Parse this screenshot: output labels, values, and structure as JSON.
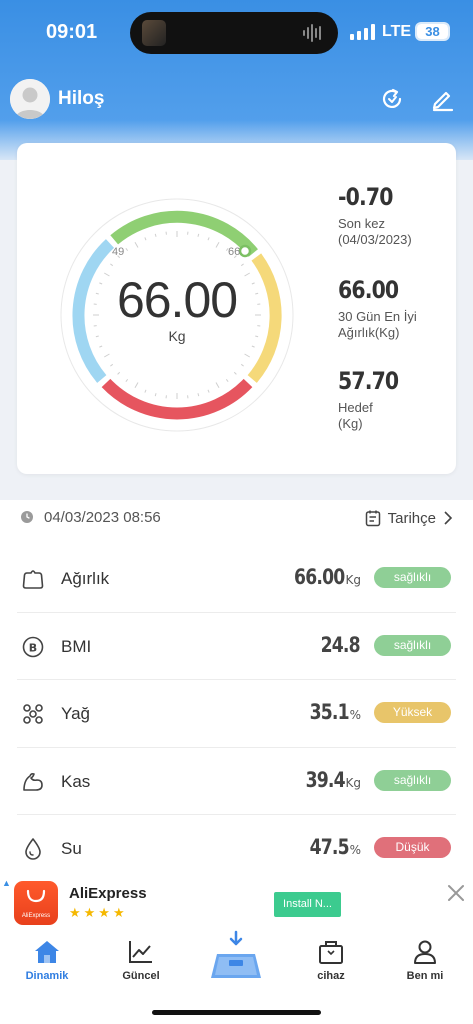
{
  "status_bar": {
    "time": "09:01",
    "network": "LTE",
    "battery": "38"
  },
  "profile": {
    "name": "Hiloş"
  },
  "gauge": {
    "value": "66.00",
    "unit": "Kg",
    "min_label": "49",
    "max_label": "66"
  },
  "stats": [
    {
      "value": "-0.70",
      "label_line1": "Son kez",
      "label_line2": "(04/03/2023)"
    },
    {
      "value": "66.00",
      "label_line1": "30 Gün En İyi",
      "label_line2": "Ağırlık(Kg)"
    },
    {
      "value": "57.70",
      "label_line1": "Hedef",
      "label_line2": "(Kg)"
    }
  ],
  "record": {
    "datetime": "04/03/2023 08:56",
    "history_label": "Tarihçe"
  },
  "metrics": [
    {
      "name": "Ağırlık",
      "value": "66.00",
      "unit": "Kg",
      "badge": "sağlıklı",
      "badge_color": "#8fcf96",
      "icon": "weight-icon"
    },
    {
      "name": "BMI",
      "value": "24.8",
      "unit": "",
      "badge": "sağlıklı",
      "badge_color": "#8fcf96",
      "icon": "bmi-icon"
    },
    {
      "name": "Yağ",
      "value": "35.1",
      "unit": "%",
      "badge": "Yüksek",
      "badge_color": "#e8c56a",
      "icon": "fat-icon"
    },
    {
      "name": "Kas",
      "value": "39.4",
      "unit": "Kg",
      "badge": "sağlıklı",
      "badge_color": "#8fcf96",
      "icon": "muscle-icon"
    },
    {
      "name": "Su",
      "value": "47.5",
      "unit": "%",
      "badge": "Düşük",
      "badge_color": "#e0707a",
      "icon": "water-drop-icon"
    }
  ],
  "ad": {
    "app_name": "AliExpress",
    "logo_text": "AliExpress",
    "stars": "★★★★",
    "install_label": "Install N..."
  },
  "tabs": [
    {
      "label": "Dinamik",
      "active": true
    },
    {
      "label": "Güncel",
      "active": false
    },
    {
      "label": "",
      "active": false
    },
    {
      "label": "cihaz",
      "active": false
    },
    {
      "label": "Ben mi",
      "active": false
    }
  ],
  "colors": {
    "accent": "#2f7de1",
    "header": "#3a8fe4",
    "gauge_green": "#8fcf73",
    "gauge_yellow": "#f5d97a",
    "gauge_red": "#e6555f",
    "gauge_blue": "#9fd6f2"
  }
}
